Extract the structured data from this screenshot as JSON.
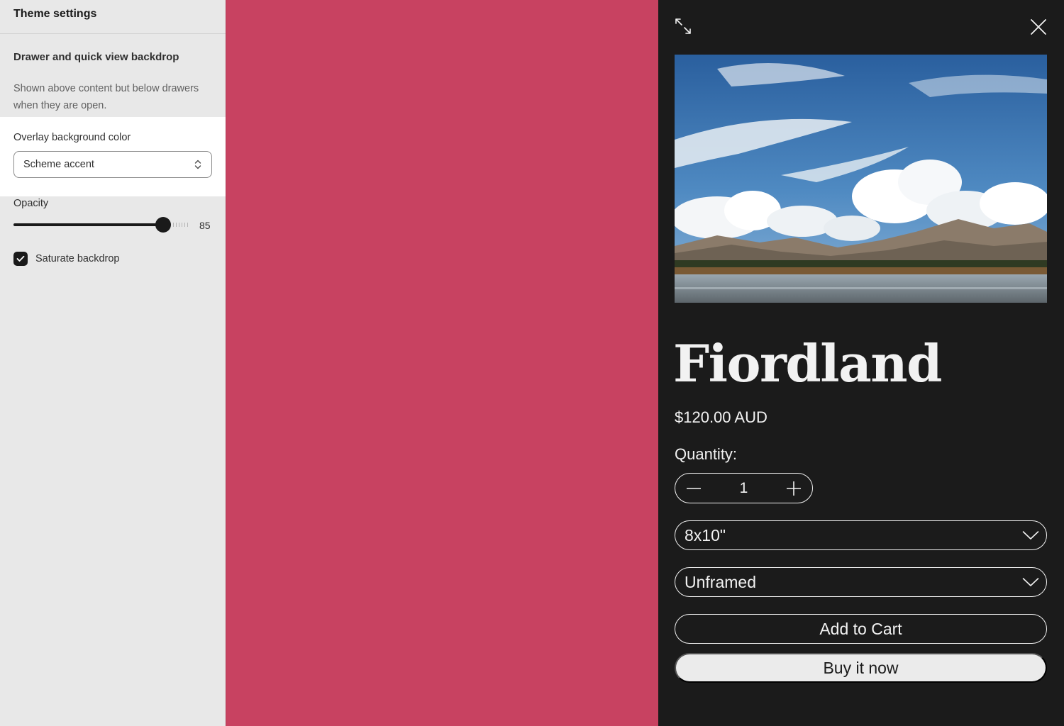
{
  "settings": {
    "header_title": "Theme settings",
    "group_title": "Drawer and quick view backdrop",
    "group_description": "Shown above content but below drawers when they are open.",
    "overlay_color": {
      "label": "Overlay background color",
      "value": "Scheme accent"
    },
    "opacity": {
      "label": "Opacity",
      "value": 85,
      "max": 100
    },
    "saturate": {
      "label": "Saturate backdrop",
      "checked": true
    }
  },
  "backdrop": {
    "color": "#c84261"
  },
  "drawer": {
    "background": "#1b1b1b",
    "expand_icon": "expand-arrows-icon",
    "close_icon": "close-icon",
    "product": {
      "title": "Fiordland",
      "price": "$120.00 AUD",
      "quantity_label": "Quantity:",
      "quantity": "1",
      "size_option": "8x10\"",
      "frame_option": "Unframed",
      "add_to_cart": "Add to Cart",
      "buy_now": "Buy it now"
    }
  }
}
